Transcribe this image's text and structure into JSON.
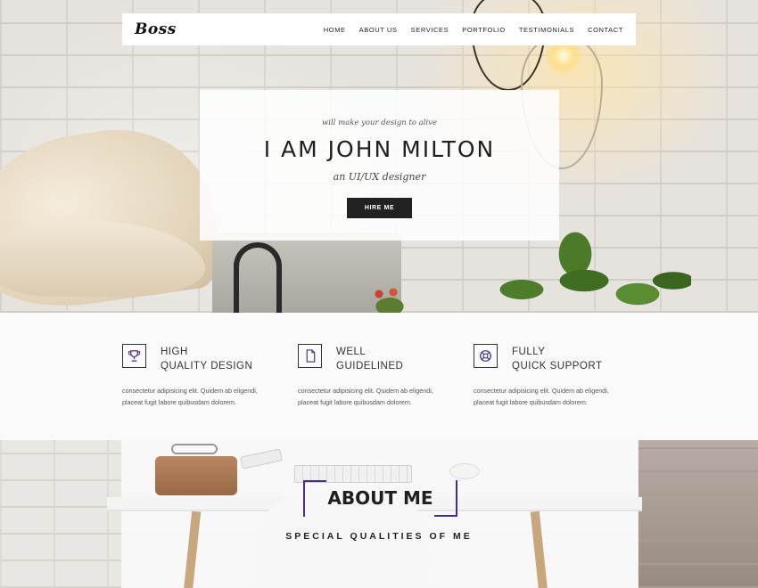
{
  "navbar": {
    "logo": "Boss",
    "links": [
      "HOME",
      "ABOUT US",
      "SERVICES",
      "PORTFOLIO",
      "TESTIMONIALS",
      "CONTACT"
    ]
  },
  "hero": {
    "tagline": "will make your design to alive",
    "title": "I AM JOHN MILTON",
    "subtitle": "an UI/UX designer",
    "cta_label": "HIRE ME"
  },
  "features": [
    {
      "icon": "trophy-icon",
      "title_line1": "HIGH",
      "title_line2": "QUALITY DESIGN",
      "desc_line1": "consectetur adipisicing elit. Quidem ab eligendi,",
      "desc_line2": "placeat fugit labore quibusdam dolorem."
    },
    {
      "icon": "document-icon",
      "title_line1": "WELL",
      "title_line2": "GUIDELINED",
      "desc_line1": "consectetur adipisicing elit. Quidem ab eligendi,",
      "desc_line2": "placeat fugit labore quibusdam dolorem."
    },
    {
      "icon": "lifebuoy-icon",
      "title_line1": "FULLY",
      "title_line2": "QUICK SUPPORT",
      "desc_line1": "consectetur adipisicing elit. Quidem ab eligendi,",
      "desc_line2": "placeat fugit labore quibusdam dolorem."
    }
  ],
  "about": {
    "title": "ABOUT ME",
    "subtitle": "SPECIAL QUALITIES OF ME"
  },
  "colors": {
    "accent": "#4a2c86",
    "dark": "#222222",
    "feature_bg": "#fafafa"
  }
}
